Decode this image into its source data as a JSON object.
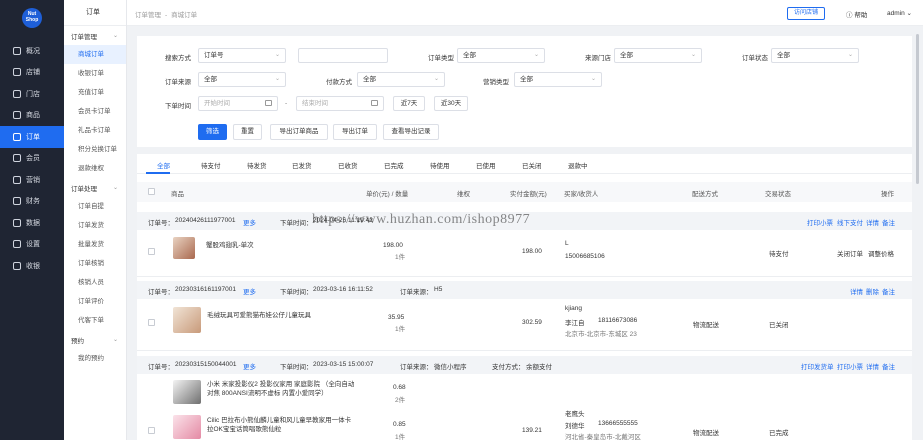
{
  "logo": {
    "line1": "Nut",
    "line2": "Shop"
  },
  "nav": [
    {
      "label": "概况",
      "name": "overview"
    },
    {
      "label": "店铺",
      "name": "store"
    },
    {
      "label": "门店",
      "name": "branch"
    },
    {
      "label": "商品",
      "name": "goods"
    },
    {
      "label": "订单",
      "name": "orders",
      "active": true
    },
    {
      "label": "会员",
      "name": "member"
    },
    {
      "label": "营销",
      "name": "marketing"
    },
    {
      "label": "财务",
      "name": "finance"
    },
    {
      "label": "数据",
      "name": "data"
    },
    {
      "label": "设置",
      "name": "settings"
    },
    {
      "label": "收银",
      "name": "cashier"
    }
  ],
  "submenu": {
    "header": "订单",
    "groups": [
      {
        "title": "订单管理",
        "items": [
          "商城订单",
          "收银订单",
          "充值订单",
          "会员卡订单",
          "礼品卡订单",
          "积分兑换订单",
          "退款维权"
        ]
      },
      {
        "title": "订单处理",
        "items": [
          "订单自提",
          "订单发货",
          "批量发货",
          "订单核销",
          "核销人员",
          "订单评价",
          "代客下单"
        ]
      },
      {
        "title": "预约",
        "items": [
          "我的预约"
        ]
      }
    ]
  },
  "topbar": {
    "crumb1": "订单管理",
    "crumb_sep": "-",
    "crumb2": "商城订单",
    "visit": "访问店铺",
    "help": "帮助",
    "admin": "admin"
  },
  "filters": {
    "search_mode_label": "搜索方式",
    "search_mode_value": "订单号",
    "search_input": "",
    "order_type_label": "订单类型",
    "order_type_value": "全部",
    "source_store_label": "来源门店",
    "source_store_value": "全部",
    "order_status_label": "订单状态",
    "order_status_value": "全部",
    "order_source_label": "订单来源",
    "order_source_value": "全部",
    "pay_method_label": "付款方式",
    "pay_method_value": "全部",
    "marketing_label": "营销类型",
    "marketing_value": "全部",
    "time_label": "下单时间",
    "start_placeholder": "开始时间",
    "end_placeholder": "结束时间",
    "range_sep": "-",
    "last7": "近7天",
    "last30": "近30天",
    "btn_filter": "筛选",
    "btn_reset": "重置",
    "btn_export_order_goods": "导出订单商品",
    "btn_export_order": "导出订单",
    "btn_export_records": "查看导出记录"
  },
  "tabs": [
    "全部",
    "待支付",
    "待发货",
    "已发货",
    "已收货",
    "已完成",
    "待使用",
    "已使用",
    "已关闭",
    "退款中"
  ],
  "columns": {
    "goods": "商品",
    "price_qty": "单价(元) / 数量",
    "after_sale": "维权",
    "paid": "实付金额(元)",
    "buyer": "买家/收货人",
    "delivery": "配送方式",
    "trade_status": "交易状态",
    "action": "操作"
  },
  "orders": [
    {
      "no_label": "订单号：",
      "no": "20240426111977001",
      "more": "更多",
      "time_label": "下单时间：",
      "time": "2024-04-26 11:19:42",
      "source": "",
      "pay": "",
      "actions": [
        "打印小票",
        "线下支付",
        "详情",
        "备注"
      ],
      "goods": [
        {
          "name": "蟹股鸡翅乳-单次",
          "price": "198.00",
          "qty": "1件"
        }
      ],
      "paid": "198.00",
      "buyer": "L",
      "phone": "15006685106",
      "address": "",
      "delivery": "",
      "status": "待支付",
      "row_actions": [
        "关闭订单",
        "调整价格"
      ]
    },
    {
      "no_label": "订单号：",
      "no": "20230316161197001",
      "more": "更多",
      "time_label": "下单时间：",
      "time": "2023-03-16 16:11:52",
      "source_label": "订单来源：",
      "source": "H5",
      "pay": "",
      "actions": [
        "详情",
        "删除",
        "备注"
      ],
      "goods": [
        {
          "name": "毛绒玩具可爱熊猫布娃公仔儿童玩具",
          "price": "35.95",
          "qty": "1件"
        }
      ],
      "paid": "302.59",
      "buyer": "kjiang",
      "receiver": "李江自",
      "phone": "18116673086",
      "address": "北京市-北京市-东城区 23",
      "delivery": "物流配送",
      "status": "已关闭",
      "row_actions": []
    },
    {
      "no_label": "订单号：",
      "no": "20230315150044001",
      "more": "更多",
      "time_label": "下单时间：",
      "time": "2023-03-15 15:00:07",
      "source_label": "订单来源：",
      "source": "微信小程序",
      "pay_label": "支付方式：",
      "pay": "余额支付",
      "actions": [
        "打印发货单",
        "打印小票",
        "详情",
        "备注"
      ],
      "goods": [
        {
          "name": "小米 米家投影仪2 投影仪家用 家庭影院 （全向自动对焦 800ANSI流明不虚标 内置小爱同学）",
          "price": "0.68",
          "qty": "2件"
        },
        {
          "name": "Cilic 巴拉布小熊仙麟儿童和风儿童早教家用一体卡拉OK宝宝话筒唱歌熊仙粒",
          "price": "0.85",
          "qty": "1件"
        }
      ],
      "paid": "139.21",
      "buyer": "老鹰头",
      "receiver": "刘德华",
      "phone": "13666555555",
      "address": "河北省-秦皇岛市-北戴河区",
      "delivery": "物流配送",
      "status": "已完成",
      "row_actions": []
    }
  ],
  "watermark": "https://www.huzhan.com/ishop8977",
  "colors": {
    "primary": "#1f6cf0",
    "sidebar": "#1f2533"
  }
}
